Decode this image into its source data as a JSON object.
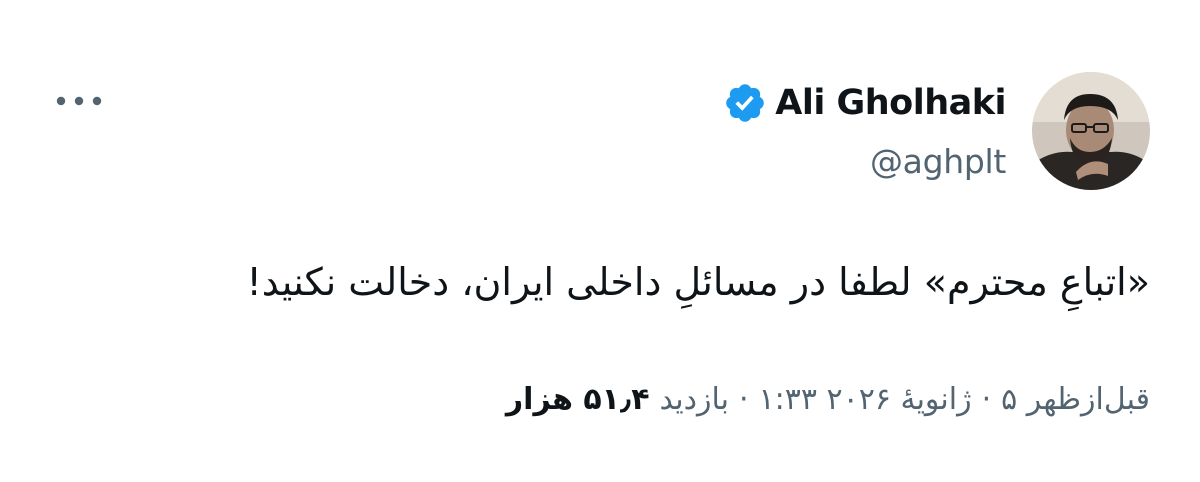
{
  "author": {
    "display_name": "Ali Gholhaki",
    "handle": "@aghplt",
    "verified": true,
    "avatar_icon": "profile-photo",
    "badge_color": "#1d9bf0"
  },
  "menu": {
    "icon": "more-horizontal-icon"
  },
  "tweet": {
    "text": "«اتباعِ محترم» لطفا در مسائلِ داخلی ایران، دخالت نکنید!"
  },
  "meta": {
    "time": "قبل‌ازظهر ۵",
    "date": "ژانویهٔ ۲۰۲۶ ۱:۳۳",
    "views_label": "بازدید",
    "views_count": "۵۱٫۴ هزار",
    "separator": "·"
  },
  "colors": {
    "text_primary": "#0f1419",
    "text_secondary": "#536471"
  }
}
